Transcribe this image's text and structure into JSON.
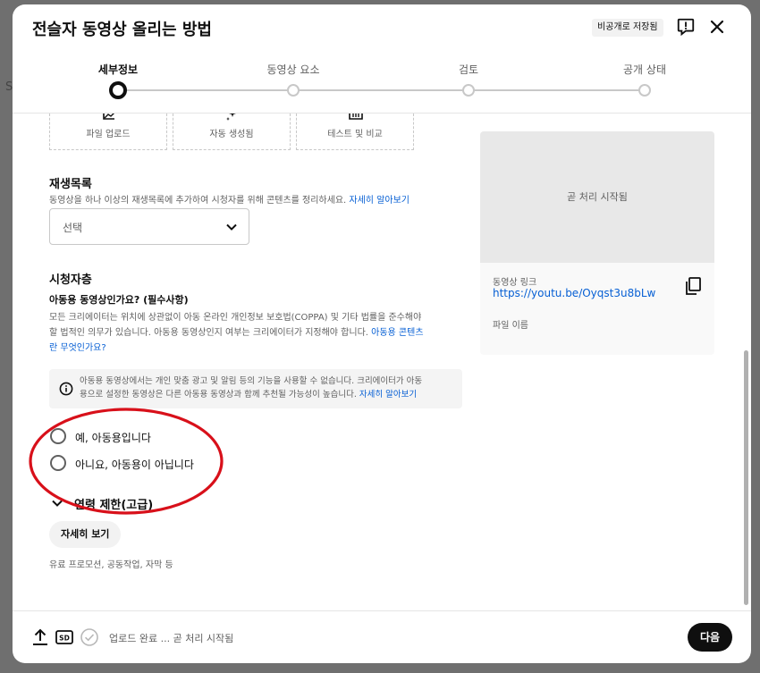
{
  "header": {
    "title": "전슬자 동영상 올리는 방법",
    "saved_badge": "비공개로 저장됨"
  },
  "stepper": {
    "steps": [
      {
        "label": "세부정보",
        "active": true
      },
      {
        "label": "동영상 요소",
        "active": false
      },
      {
        "label": "검토",
        "active": false
      },
      {
        "label": "공개 상태",
        "active": false
      }
    ]
  },
  "thumbnails": [
    {
      "label": "파일 업로드",
      "icon": "image-upload-icon"
    },
    {
      "label": "자동 생성됨",
      "icon": "auto-generate-icon"
    },
    {
      "label": "테스트 및 비교",
      "icon": "test-compare-icon"
    }
  ],
  "playlist": {
    "title": "재생목록",
    "description": "동영상을 하나 이상의 재생목록에 추가하여 시청자를 위해 콘텐츠를 정리하세요.",
    "learn_more": "자세히 알아보기",
    "select_placeholder": "선택"
  },
  "audience": {
    "title": "시청자층",
    "question": "아동용 동영상인가요? (필수사항)",
    "paragraph_line1": "모든 크리에이터는 위치에 상관없이 아동 온라인 개인정보 보호법(COPPA) 및 기타 법률을 준수해야",
    "paragraph_line2": "할 법적인 의무가 있습니다. 아동용 동영상인지 여부는 크리에이터가 지정해야 합니다.",
    "paragraph_link1": "아동용 콘텐츠",
    "paragraph_link2": "란 무엇인가요?",
    "info_line1": "아동용 동영상에서는 개인 맞춤 광고 및 알림 등의 기능을 사용할 수 없습니다. 크리에이터가 아동",
    "info_line2": "용으로 설정한 동영상은 다른 아동용 동영상과 함께 추천될 가능성이 높습니다.",
    "info_link": "자세히 알아보기",
    "option_yes": "예, 아동용입니다",
    "option_no": "아니요, 아동용이 아닙니다",
    "age_restriction": "연령 제한(고급)"
  },
  "more": {
    "button": "자세히 보기",
    "sub": "유료 프로모션, 공동작업, 자막 등"
  },
  "preview": {
    "status": "곧 처리 시작됨",
    "link_label": "동영상 링크",
    "link": "https://youtu.be/Oyqst3u8bLw",
    "filename_label": "파일 이름"
  },
  "footer": {
    "status": "업로드 완료 ... 곧 처리 시작됨",
    "sd_label": "SD",
    "next": "다음"
  },
  "colors": {
    "accent_link": "#065fd4",
    "annotation_red": "#d8101a",
    "primary_button": "#0f0f0f"
  }
}
